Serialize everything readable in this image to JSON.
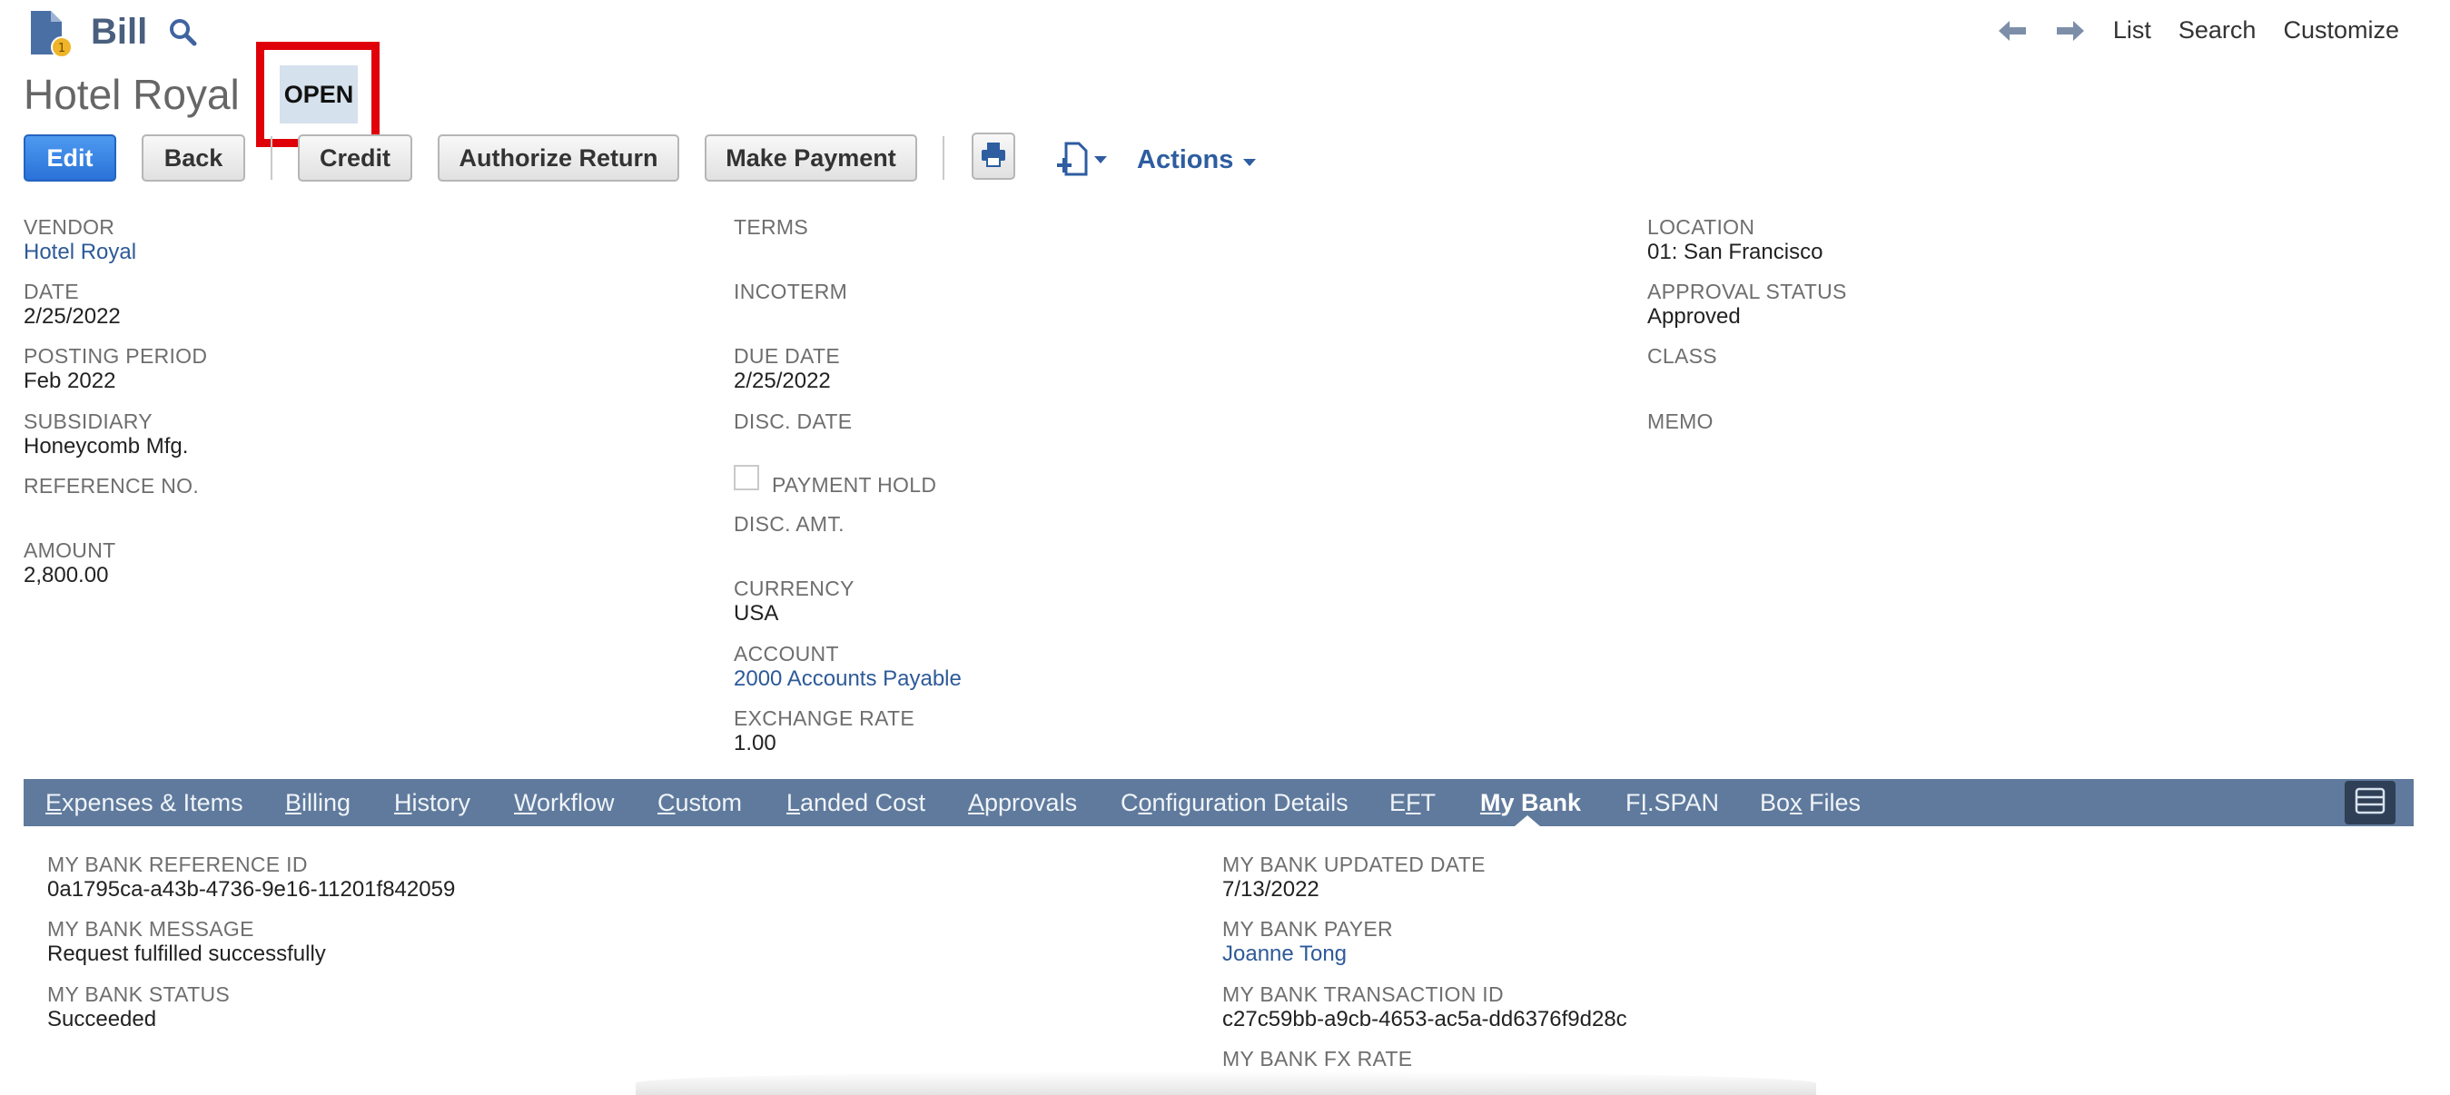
{
  "header": {
    "record_type": "Bill",
    "title": "Hotel Royal",
    "status": "OPEN",
    "nav": {
      "list": "List",
      "search": "Search",
      "customize": "Customize"
    }
  },
  "toolbar": {
    "edit": "Edit",
    "back": "Back",
    "credit": "Credit",
    "authorize_return": "Authorize Return",
    "make_payment": "Make Payment",
    "actions": "Actions"
  },
  "fields": {
    "vendor": {
      "label": "VENDOR",
      "value": "Hotel Royal"
    },
    "date": {
      "label": "DATE",
      "value": "2/25/2022"
    },
    "posting_period": {
      "label": "POSTING PERIOD",
      "value": "Feb 2022"
    },
    "subsidiary": {
      "label": "SUBSIDIARY",
      "value": "Honeycomb Mfg."
    },
    "reference_no": {
      "label": "REFERENCE NO.",
      "value": ""
    },
    "amount": {
      "label": "AMOUNT",
      "value": "2,800.00"
    },
    "terms": {
      "label": "TERMS",
      "value": ""
    },
    "incoterm": {
      "label": "INCOTERM",
      "value": ""
    },
    "due_date": {
      "label": "DUE DATE",
      "value": "2/25/2022"
    },
    "disc_date": {
      "label": "DISC. DATE",
      "value": ""
    },
    "payment_hold": {
      "label": "PAYMENT HOLD",
      "checked": false
    },
    "disc_amt": {
      "label": "DISC. AMT.",
      "value": ""
    },
    "currency": {
      "label": "CURRENCY",
      "value": "USA"
    },
    "account": {
      "label": "ACCOUNT",
      "value": "2000 Accounts Payable"
    },
    "exchange_rate": {
      "label": "EXCHANGE RATE",
      "value": "1.00"
    },
    "location": {
      "label": "LOCATION",
      "value": "01: San Francisco"
    },
    "approval_status": {
      "label": "APPROVAL STATUS",
      "value": "Approved"
    },
    "class": {
      "label": "CLASS",
      "value": ""
    },
    "memo": {
      "label": "MEMO",
      "value": ""
    }
  },
  "subtabs": [
    {
      "pre": "",
      "key": "E",
      "post": "xpenses & Items"
    },
    {
      "pre": "",
      "key": "B",
      "post": "illing"
    },
    {
      "pre": "",
      "key": "H",
      "post": "istory"
    },
    {
      "pre": "",
      "key": "W",
      "post": "orkflow"
    },
    {
      "pre": "",
      "key": "C",
      "post": "ustom"
    },
    {
      "pre": "",
      "key": "L",
      "post": "anded Cost"
    },
    {
      "pre": "",
      "key": "A",
      "post": "pprovals"
    },
    {
      "pre": "C",
      "key": "o",
      "post": "nfiguration Details"
    },
    {
      "pre": "E",
      "key": "F",
      "post": "T"
    },
    {
      "pre": "",
      "key": "M",
      "post": "y Bank",
      "active": true
    },
    {
      "pre": "F",
      "key": "I",
      "post": ".SPAN"
    },
    {
      "pre": "Bo",
      "key": "x",
      "post": " Files"
    }
  ],
  "mybank": {
    "reference_id": {
      "label": "MY BANK REFERENCE ID",
      "value": "0a1795ca-a43b-4736-9e16-11201f842059"
    },
    "message": {
      "label": "MY BANK MESSAGE",
      "value": "Request fulfilled successfully"
    },
    "status": {
      "label": "MY BANK STATUS",
      "value": "Succeeded"
    },
    "updated_date": {
      "label": "MY BANK UPDATED DATE",
      "value": "7/13/2022"
    },
    "payer": {
      "label": "MY BANK PAYER",
      "value": "Joanne Tong"
    },
    "transaction_id": {
      "label": "MY BANK TRANSACTION ID",
      "value": "c27c59bb-a9cb-4653-ac5a-dd6376f9d28c"
    },
    "fx_rate": {
      "label": "MY BANK FX RATE",
      "value": ""
    }
  },
  "colors": {
    "link": "#2d5a98",
    "subtab_bar": "#5f7a9c",
    "primary_button": "#2a72d8",
    "highlight": "#e0000a",
    "status_badge": "#d5e1ec"
  },
  "icons": [
    "bill-icon",
    "search-icon",
    "back-arrow-icon",
    "forward-arrow-icon",
    "print-icon",
    "new-document-icon",
    "chevron-down-icon",
    "layout-toggle-icon"
  ]
}
